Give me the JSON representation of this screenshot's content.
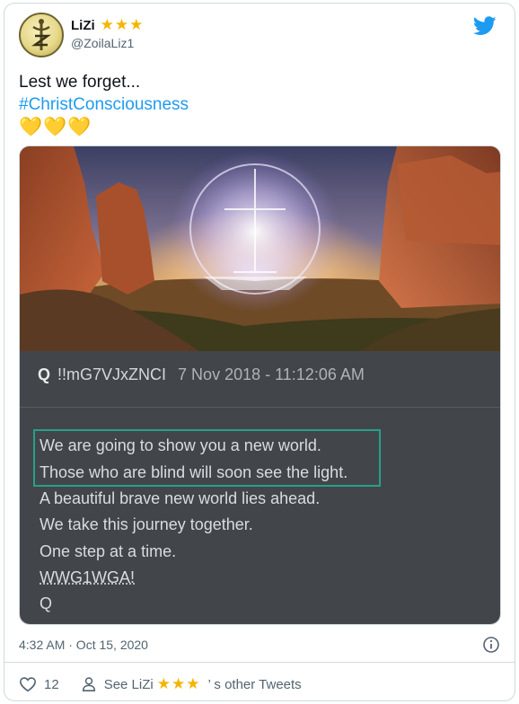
{
  "user": {
    "name": "LiZi",
    "stars": "★★★",
    "handle": "@ZoilaLiz1"
  },
  "tweet": {
    "line1": "Lest we forget...",
    "hashtag": "#ChristConsciousness",
    "hearts": "💛💛💛"
  },
  "q_post": {
    "mark": "Q",
    "tripcode": "!!mG7VJxZNCI",
    "date": "7 Nov 2018 - 11:12:06 AM",
    "lines": [
      "We are going to show you a new world.",
      "Those who are blind will soon see the light.",
      "A beautiful brave new world lies ahead.",
      "We take this journey together.",
      "One step at a time.",
      "WWG1WGA!",
      "Q"
    ]
  },
  "footer": {
    "timestamp": "4:32 AM · Oct 15, 2020",
    "like_count": "12",
    "see_label": "See LiZi",
    "stars": "★★★",
    "other_tweets": "’ s other Tweets"
  },
  "colors": {
    "link": "#1d9bf0",
    "star": "#f5b400",
    "highlight_box": "#27a088",
    "q_panel_bg": "#42464b"
  },
  "icons": [
    "twitter-bird-icon",
    "info-icon",
    "heart-icon",
    "person-icon"
  ]
}
